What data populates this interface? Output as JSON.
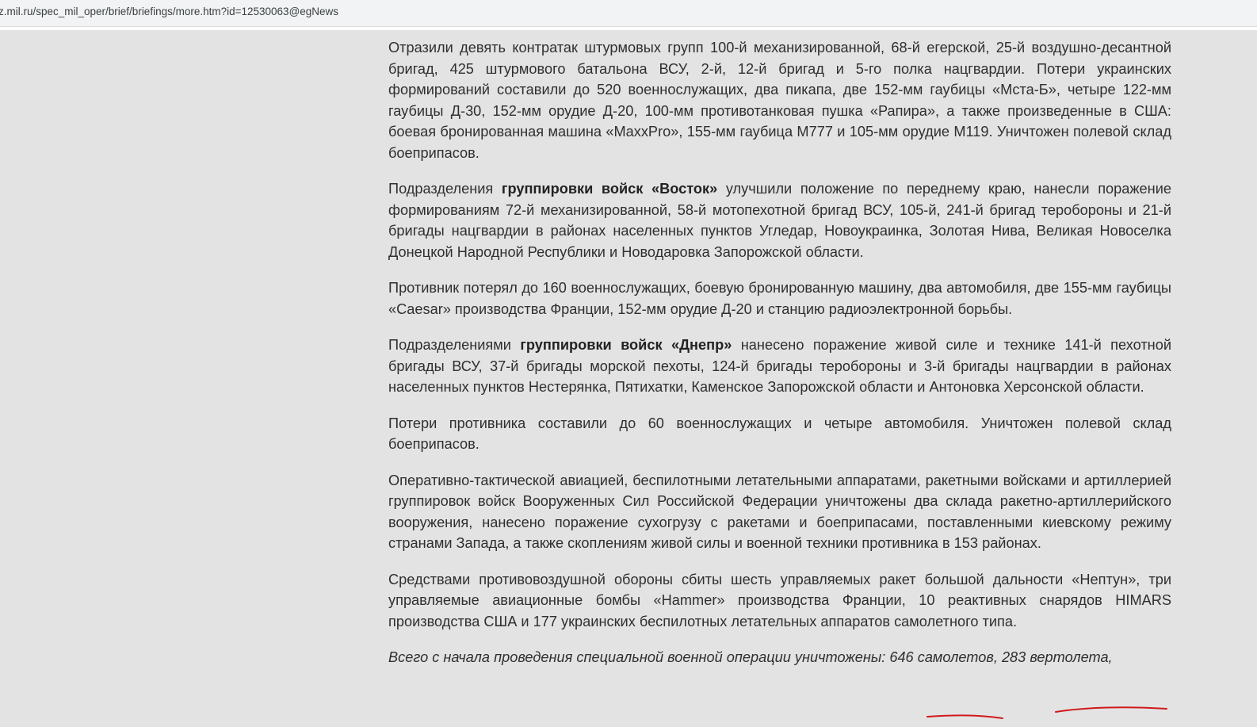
{
  "browser": {
    "url": "z.mil.ru/spec_mil_oper/brief/briefings/more.htm?id=12530063@egNews"
  },
  "article": {
    "p1": "Отразили девять контратак штурмовых групп 100-й механизированной, 68-й егерской, 25-й воздушно-десантной бригад, 425 штурмового батальона ВСУ, 2-й, 12-й бригад и 5-го полка нацгвардии. Потери украинских формирований составили до 520 военнослужащих, два пикапа, две 152-мм гаубицы «Мста-Б», четыре 122-мм гаубицы Д-30, 152-мм орудие Д-20, 100-мм противотанковая пушка «Рапира», а также произведенные в США: боевая бронированная машина «MaxxPro», 155-мм гаубица М777 и 105-мм орудие М119. Уничтожен полевой склад боеприпасов.",
    "p2_prefix": "Подразделения ",
    "p2_bold": "группировки войск «Восток»",
    "p2_suffix": " улучшили положение по переднему краю, нанесли поражение формированиям 72-й механизированной, 58-й мотопехотной бригад ВСУ, 105-й, 241-й бригад теробороны и 21-й бригады нацгвардии в районах населенных пунктов Угледар, Новоукраинка, Золотая Нива, Великая Новоселка Донецкой Народной Республики и Новодаровка Запорожской области.",
    "p3": "Противник потерял до 160 военнослужащих, боевую бронированную машину, два автомобиля, две 155-мм гаубицы «Caesar» производства Франции, 152-мм орудие Д-20 и станцию радиоэлектронной борьбы.",
    "p4_prefix": "Подразделениями ",
    "p4_bold": "группировки войск «Днепр»",
    "p4_suffix": " нанесено поражение живой силе и технике 141-й пехотной бригады ВСУ, 37-й бригады морской пехоты, 124-й бригады теробороны и 3-й бригады нацгвардии в районах населенных пунктов Нестерянка, Пятихатки, Каменское Запорожской области и Антоновка Херсонской области.",
    "p5": "Потери противника составили до 60 военнослужащих и четыре автомобиля. Уничтожен полевой склад боеприпасов.",
    "p6": "Оперативно-тактической авиацией, беспилотными летательными аппаратами, ракетными войсками и артиллерией группировок войск Вооруженных Сил Российской Федерации уничтожены два склада ракетно-артиллерийского вооружения, нанесено поражение сухогрузу с ракетами и боеприпасами, поставленными киевскому режиму странами Запада, а также скоплениям живой силы и военной техники противника в 153 районах.",
    "p7": "Средствами противовоздушной обороны сбиты шесть управляемых ракет большой дальности «Нептун», три управляемые авиационные бомбы «Hammer» производства Франции, 10 реактивных снарядов HIMARS производства США и 177 украинских беспилотных летательных аппаратов самолетного типа.",
    "p8": "Всего с начала проведения специальной военной операции уничтожены: 646 самолетов, 283 вертолета,"
  },
  "colors": {
    "page_background": "#e3e3e3",
    "text": "#2f2f2f",
    "annotation_red": "#d11a1a"
  }
}
